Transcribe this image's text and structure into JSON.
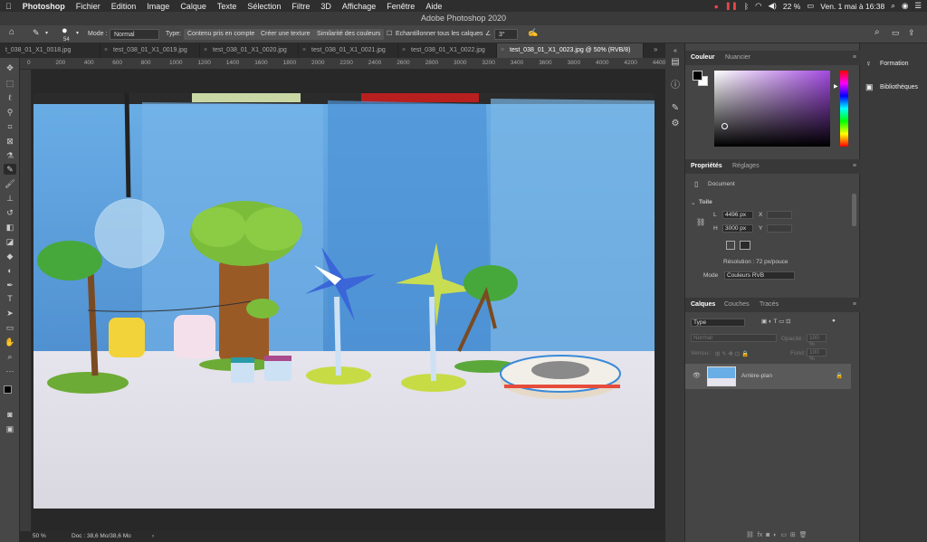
{
  "menubar": {
    "apple": "",
    "app_name": "Photoshop",
    "items": [
      "Fichier",
      "Edition",
      "Image",
      "Calque",
      "Texte",
      "Sélection",
      "Filtre",
      "3D",
      "Affichage",
      "Fenêtre",
      "Aide"
    ],
    "battery": "22 %",
    "datetime": "Ven. 1 mai à 16:38"
  },
  "window_title": "Adobe Photoshop 2020",
  "options_bar": {
    "brush_size": "54",
    "mode_label": "Mode :",
    "mode_value": "Normal",
    "type_label": "Type:",
    "type_options": [
      "Contenu pris en compte",
      "Créer une texture",
      "Similarité des couleurs"
    ],
    "sample_all_label": "Echantillonner tous les calques",
    "angle_value": "3°"
  },
  "tabs": [
    {
      "label": "t_038_01_X1_0018.jpg",
      "active": false
    },
    {
      "label": "test_038_01_X1_0019.jpg",
      "active": false
    },
    {
      "label": "test_038_01_X1_0020.jpg",
      "active": false
    },
    {
      "label": "test_038_01_X1_0021.jpg",
      "active": false
    },
    {
      "label": "test_038_01_X1_0022.jpg",
      "active": false
    },
    {
      "label": "test_038_01_X1_0023.jpg @ 50% (RVB/8)",
      "active": true
    }
  ],
  "ruler_ticks": [
    "0",
    "200",
    "400",
    "600",
    "800",
    "1000",
    "1200",
    "1400",
    "1600",
    "1800",
    "2000",
    "2200",
    "2400",
    "2600",
    "2800",
    "3000",
    "3200",
    "3400",
    "3600",
    "3800",
    "4000",
    "4200",
    "4400"
  ],
  "status": {
    "zoom": "50 %",
    "doc": "Doc : 38,6 Mo/38,6 Mo"
  },
  "color_panel": {
    "tabs": [
      "Couleur",
      "Nuancier"
    ]
  },
  "properties_panel": {
    "tabs": [
      "Propriétés",
      "Réglages"
    ],
    "doc_label": "Document",
    "section": "Toile",
    "w_label": "L",
    "w_value": "4496 px",
    "h_label": "H",
    "h_value": "3000 px",
    "x_label": "X",
    "y_label": "Y",
    "resolution": "Résolution : 72 px/pouce",
    "mode_label": "Mode",
    "mode_value": "Couleurs RVB"
  },
  "layers_panel": {
    "tabs": [
      "Calques",
      "Couches",
      "Tracés"
    ],
    "kind_placeholder": "Type",
    "blend_mode": "Normal",
    "opacity_label": "Opacité :",
    "opacity_value": "100 %",
    "lock_label": "Verrou :",
    "fill_label": "Fond :",
    "fill_value": "100 %",
    "layer_name": "Arrière-plan"
  },
  "right_panel": {
    "items": [
      "Formation",
      "Bibliothèques"
    ]
  },
  "colors": {
    "accent": "#2d8ceb",
    "panel": "#454545",
    "dark": "#2c2c2c"
  }
}
